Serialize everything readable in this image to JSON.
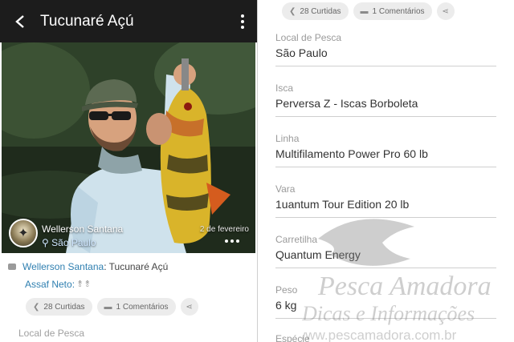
{
  "left": {
    "header": {
      "title": "Tucunaré Açú"
    },
    "post": {
      "user_name": "Wellerson Santana",
      "location": "São Paulo",
      "date": "2 de fevereiro"
    },
    "comment": {
      "author": "Wellerson Santana",
      "text": ": Tucunaré Açú"
    },
    "like_user": "Assaf Neto:",
    "actions": {
      "likes": "28 Curtidas",
      "comments": "1 Comentários"
    },
    "first_label": "Local de Pesca"
  },
  "right": {
    "actions": {
      "likes": "28 Curtidas",
      "comments": "1 Comentários"
    },
    "fields": [
      {
        "label": "Local de Pesca",
        "value": "São Paulo"
      },
      {
        "label": "Isca",
        "value": "Perversa Z - Iscas Borboleta"
      },
      {
        "label": "Linha",
        "value": "Multifilamento Power Pro 60 lb"
      },
      {
        "label": "Vara",
        "value": "1uantum Tour Edition 20 lb"
      },
      {
        "label": "Carretilha",
        "value": "Quantum Energy"
      },
      {
        "label": "Peso",
        "value": "6 kg"
      },
      {
        "label": "Espécie",
        "value": ""
      }
    ]
  },
  "watermark": {
    "line1": "Pesca Amadora",
    "line2": "Dicas e Informações",
    "line3": "www.pescamadora.com.br"
  },
  "colors": {
    "topbar": "#1c1c1c",
    "link": "#2f7fb0",
    "chip_bg": "#ececec"
  }
}
